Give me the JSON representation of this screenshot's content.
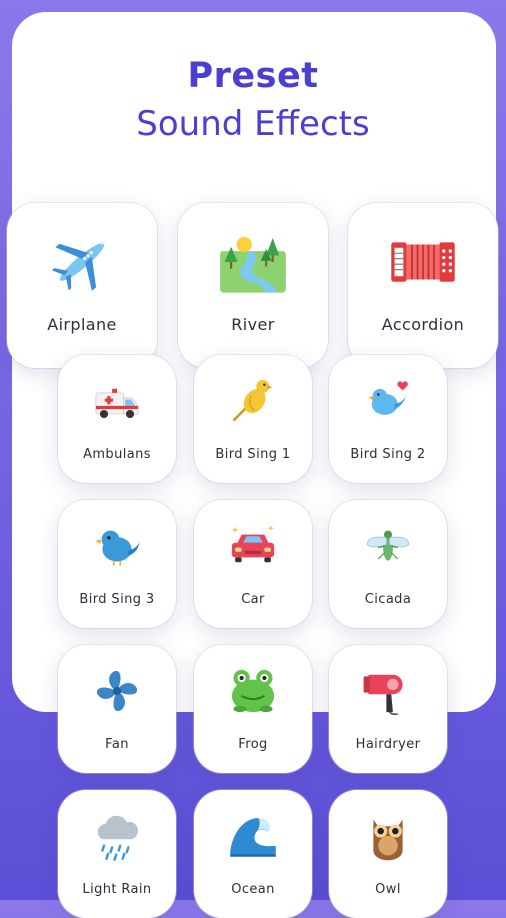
{
  "header": {
    "title_bold": "Preset",
    "title_sub": "Sound Effects"
  },
  "colors": {
    "accent": "#4b3fd0",
    "bg_top": "#8b78ea",
    "bg_bottom": "#5a4fd6"
  },
  "featured": [
    {
      "label": "Airplane",
      "icon": "airplane-icon"
    },
    {
      "label": "River",
      "icon": "river-icon"
    },
    {
      "label": "Accordion",
      "icon": "accordion-icon"
    }
  ],
  "grid": [
    {
      "label": "Ambulans",
      "icon": "ambulance-icon"
    },
    {
      "label": "Bird Sing 1",
      "icon": "canary-icon"
    },
    {
      "label": "Bird Sing 2",
      "icon": "bird-heart-icon"
    },
    {
      "label": "Bird Sing 3",
      "icon": "bluebird-icon"
    },
    {
      "label": "Car",
      "icon": "car-icon"
    },
    {
      "label": "Cicada",
      "icon": "cicada-icon"
    },
    {
      "label": "Fan",
      "icon": "fan-icon"
    },
    {
      "label": "Frog",
      "icon": "frog-icon"
    },
    {
      "label": "Hairdryer",
      "icon": "hairdryer-icon"
    },
    {
      "label": "Light Rain",
      "icon": "rain-cloud-icon"
    },
    {
      "label": "Ocean",
      "icon": "wave-icon"
    },
    {
      "label": "Owl",
      "icon": "owl-icon"
    }
  ]
}
